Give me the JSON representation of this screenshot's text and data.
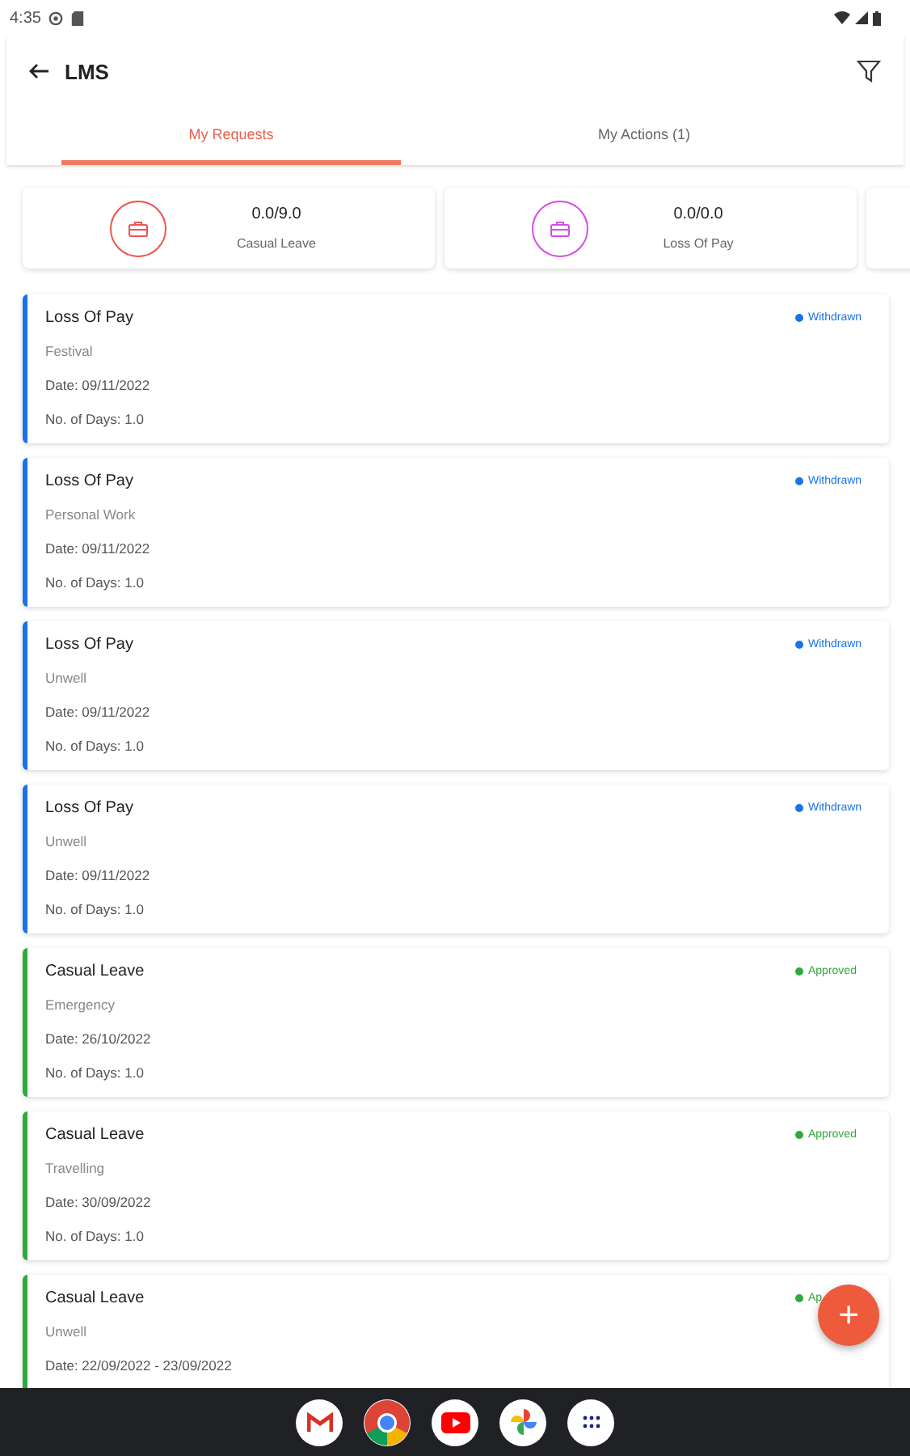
{
  "status_bar": {
    "time": "4:35"
  },
  "app_bar": {
    "title": "LMS"
  },
  "tabs": [
    {
      "label": "My Requests",
      "selected": true
    },
    {
      "label": "My Actions (1)",
      "selected": false
    }
  ],
  "balances": [
    {
      "value": "0.0/9.0",
      "label": "Casual Leave",
      "color": "#ef5350"
    },
    {
      "value": "0.0/0.0",
      "label": "Loss Of Pay",
      "color": "#d64ce8"
    }
  ],
  "requests": [
    {
      "type": "Loss Of Pay",
      "reason": "Festival",
      "date": "Date: 09/11/2022",
      "days": "No. of Days: 1.0",
      "status": "Withdrawn",
      "color": "#1a73e8"
    },
    {
      "type": "Loss Of Pay",
      "reason": "Personal Work",
      "date": "Date: 09/11/2022",
      "days": "No. of Days: 1.0",
      "status": "Withdrawn",
      "color": "#1a73e8"
    },
    {
      "type": "Loss Of Pay",
      "reason": "Unwell",
      "date": "Date: 09/11/2022",
      "days": "No. of Days: 1.0",
      "status": "Withdrawn",
      "color": "#1a73e8"
    },
    {
      "type": "Loss Of Pay",
      "reason": "Unwell",
      "date": "Date: 09/11/2022",
      "days": "No. of Days: 1.0",
      "status": "Withdrawn",
      "color": "#1a73e8"
    },
    {
      "type": "Casual Leave",
      "reason": "Emergency",
      "date": "Date: 26/10/2022",
      "days": "No. of Days: 1.0",
      "status": "Approved",
      "color": "#2eaa3a"
    },
    {
      "type": "Casual Leave",
      "reason": "Travelling",
      "date": "Date: 30/09/2022",
      "days": "No. of Days: 1.0",
      "status": "Approved",
      "color": "#2eaa3a"
    },
    {
      "type": "Casual Leave",
      "reason": "Unwell",
      "date": "Date: 22/09/2022 - 23/09/2022",
      "status": "Ap",
      "color": "#2eaa3a"
    }
  ],
  "fab": {
    "label": "+"
  }
}
